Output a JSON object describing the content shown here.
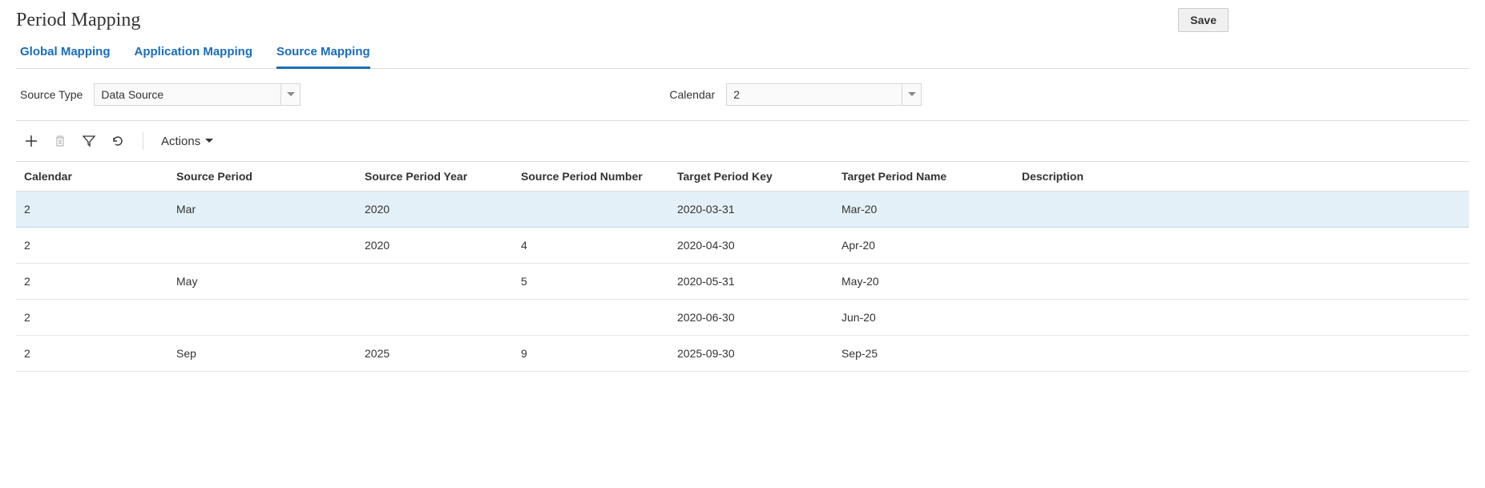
{
  "page": {
    "title": "Period Mapping",
    "save_label": "Save"
  },
  "tabs": [
    {
      "label": "Global Mapping",
      "active": false
    },
    {
      "label": "Application Mapping",
      "active": false
    },
    {
      "label": "Source Mapping",
      "active": true
    }
  ],
  "filters": {
    "source_type_label": "Source Type",
    "source_type_value": "Data Source",
    "calendar_label": "Calendar",
    "calendar_value": "2"
  },
  "toolbar": {
    "actions_label": "Actions"
  },
  "table": {
    "columns": [
      "Calendar",
      "Source Period",
      "Source Period Year",
      "Source Period Number",
      "Target Period Key",
      "Target Period Name",
      "Description"
    ],
    "rows": [
      {
        "selected": true,
        "calendar": "2",
        "source_period": "Mar",
        "source_year": "2020",
        "source_num": "",
        "target_key": "2020-03-31",
        "target_name": "Mar-20",
        "desc": ""
      },
      {
        "selected": false,
        "calendar": "2",
        "source_period": "",
        "source_year": "2020",
        "source_num": "4",
        "target_key": "2020-04-30",
        "target_name": "Apr-20",
        "desc": ""
      },
      {
        "selected": false,
        "calendar": "2",
        "source_period": "May",
        "source_year": "",
        "source_num": "5",
        "target_key": "2020-05-31",
        "target_name": "May-20",
        "desc": ""
      },
      {
        "selected": false,
        "calendar": "2",
        "source_period": "",
        "source_year": "",
        "source_num": "",
        "target_key": "2020-06-30",
        "target_name": "Jun-20",
        "desc": ""
      },
      {
        "selected": false,
        "calendar": "2",
        "source_period": "Sep",
        "source_year": "2025",
        "source_num": "9",
        "target_key": "2025-09-30",
        "target_name": "Sep-25",
        "desc": ""
      }
    ]
  }
}
